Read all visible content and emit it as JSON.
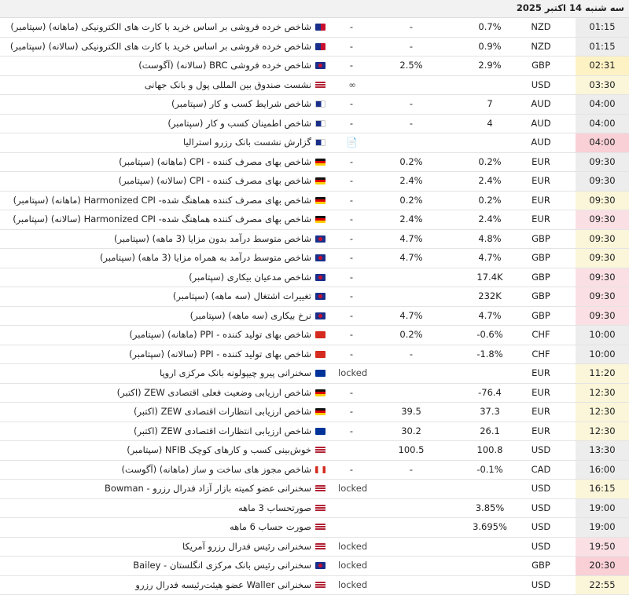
{
  "header": {
    "title": "سه شنبه 14 اکتبر 2025"
  },
  "events": [
    {
      "time": "01:15",
      "currency": "NZD",
      "actual": "0.7%",
      "forecast": "-",
      "previous": "-",
      "flag": "nz",
      "icon": "",
      "event": "شاخص خرده فروشی بر اساس خرید با کارت های الکترونیکی (ماهانه) (سپتامبر)",
      "highlight": ""
    },
    {
      "time": "01:15",
      "currency": "NZD",
      "actual": "0.9%",
      "forecast": "-",
      "previous": "-",
      "flag": "nz",
      "icon": "",
      "event": "شاخص خرده فروشی بر اساس خرید با کارت های الکترونیکی (سالانه) (سپتامبر)",
      "highlight": ""
    },
    {
      "time": "02:31",
      "currency": "GBP",
      "actual": "2.9%",
      "forecast": "2.5%",
      "previous": "-",
      "flag": "gb",
      "icon": "",
      "event": "شاخص خرده فروشی BRC (سالانه) (آگوست)",
      "highlight": "o"
    },
    {
      "time": "03:30",
      "currency": "USD",
      "actual": "",
      "forecast": "",
      "previous": "",
      "flag": "us",
      "icon": "∞",
      "event": "نشست صندوق بین المللی پول و بانک جهانی",
      "highlight": "y"
    },
    {
      "time": "04:00",
      "currency": "AUD",
      "actual": "7",
      "forecast": "-",
      "previous": "-",
      "flag": "au",
      "icon": "",
      "event": "شاخص شرایط کسب و کار (سپتامبر)",
      "highlight": ""
    },
    {
      "time": "04:00",
      "currency": "AUD",
      "actual": "4",
      "forecast": "-",
      "previous": "-",
      "flag": "au",
      "icon": "",
      "event": "شاخص اطمینان کسب و کار (سپتامبر)",
      "highlight": ""
    },
    {
      "time": "04:00",
      "currency": "AUD",
      "actual": "",
      "forecast": "",
      "previous": "",
      "flag": "au",
      "icon": "📄",
      "event": "گزارش نشست بانک رزرو استرالیا",
      "highlight": "r"
    },
    {
      "time": "09:30",
      "currency": "EUR",
      "actual": "0.2%",
      "forecast": "0.2%",
      "previous": "-",
      "flag": "de",
      "icon": "",
      "event": "شاخص بهای مصرف کننده - CPI (ماهانه) (سپتامبر)",
      "highlight": ""
    },
    {
      "time": "09:30",
      "currency": "EUR",
      "actual": "2.4%",
      "forecast": "2.4%",
      "previous": "-",
      "flag": "de",
      "icon": "",
      "event": "شاخص بهای مصرف کننده - CPI (سالانه) (سپتامبر)",
      "highlight": ""
    },
    {
      "time": "09:30",
      "currency": "EUR",
      "actual": "0.2%",
      "forecast": "0.2%",
      "previous": "-",
      "flag": "de",
      "icon": "",
      "event": "شاخص بهای مصرف کننده هماهنگ شده- Harmonized CPI (ماهانه) (سپتامبر)",
      "highlight": "y"
    },
    {
      "time": "09:30",
      "currency": "EUR",
      "actual": "2.4%",
      "forecast": "2.4%",
      "previous": "-",
      "flag": "de",
      "icon": "",
      "event": "شاخص بهای مصرف کننده هماهنگ شده- Harmonized CPI (سالانه) (سپتامبر)",
      "highlight": "p"
    },
    {
      "time": "09:30",
      "currency": "GBP",
      "actual": "4.8%",
      "forecast": "4.7%",
      "previous": "-",
      "flag": "gb",
      "icon": "",
      "event": "شاخص متوسط درآمد بدون مزایا (3 ماهه) (سپتامبر)",
      "highlight": "y"
    },
    {
      "time": "09:30",
      "currency": "GBP",
      "actual": "4.7%",
      "forecast": "4.7%",
      "previous": "-",
      "flag": "gb",
      "icon": "",
      "event": "شاخص متوسط درآمد به همراه مزایا (3 ماهه) (سپتامبر)",
      "highlight": "y"
    },
    {
      "time": "09:30",
      "currency": "GBP",
      "actual": "17.4K",
      "forecast": "",
      "previous": "-",
      "flag": "gb",
      "icon": "",
      "event": "شاخص مدعیان بیکاری (سپتامبر)",
      "highlight": "p"
    },
    {
      "time": "09:30",
      "currency": "GBP",
      "actual": "232K",
      "forecast": "",
      "previous": "-",
      "flag": "gb",
      "icon": "",
      "event": "تغییرات اشتغال (سه ماهه) (سپتامبر)",
      "highlight": "p"
    },
    {
      "time": "09:30",
      "currency": "GBP",
      "actual": "4.7%",
      "forecast": "4.7%",
      "previous": "-",
      "flag": "gb",
      "icon": "",
      "event": "نرخ بیکاری (سه ماهه) (سپتامبر)",
      "highlight": "p"
    },
    {
      "time": "10:00",
      "currency": "CHF",
      "actual": "-0.6%",
      "forecast": "0.2%",
      "previous": "-",
      "flag": "ch",
      "icon": "",
      "event": "شاخص بهای تولید کننده - PPI (ماهانه) (سپتامبر)",
      "highlight": ""
    },
    {
      "time": "10:00",
      "currency": "CHF",
      "actual": "-1.8%",
      "forecast": "-",
      "previous": "-",
      "flag": "ch",
      "icon": "",
      "event": "شاخص بهای تولید کننده - PPI (سالانه) (سپتامبر)",
      "highlight": ""
    },
    {
      "time": "11:20",
      "currency": "EUR",
      "actual": "",
      "forecast": "",
      "previous": "",
      "flag": "eu",
      "icon": "locked",
      "event": "سخنرانی پیرو چیپولونه بانک مرکزی اروپا",
      "highlight": "y"
    },
    {
      "time": "12:30",
      "currency": "EUR",
      "actual": "-76.4",
      "forecast": "",
      "previous": "-",
      "flag": "de",
      "icon": "",
      "event": "شاخص ارزیابی وضعیت فعلی اقتصادی ZEW (اکتبر)",
      "highlight": "y"
    },
    {
      "time": "12:30",
      "currency": "EUR",
      "actual": "37.3",
      "forecast": "39.5",
      "previous": "-",
      "flag": "de",
      "icon": "",
      "event": "شاخص ارزیابی انتظارات اقتصادی ZEW (اکتبر)",
      "highlight": "y"
    },
    {
      "time": "12:30",
      "currency": "EUR",
      "actual": "26.1",
      "forecast": "30.2",
      "previous": "-",
      "flag": "eu",
      "icon": "",
      "event": "شاخص ارزیابی انتظارات اقتصادی ZEW (اکتبر)",
      "highlight": "y"
    },
    {
      "time": "13:30",
      "currency": "USD",
      "actual": "100.8",
      "forecast": "100.5",
      "previous": "",
      "flag": "us",
      "icon": "",
      "event": "خوش‌بینی کسب و کارهای کوچک NFIB (سپتامبر)",
      "highlight": ""
    },
    {
      "time": "16:00",
      "currency": "CAD",
      "actual": "-0.1%",
      "forecast": "-",
      "previous": "-",
      "flag": "ca",
      "icon": "",
      "event": "شاخص مجوز های ساخت و ساز (ماهانه) (آگوست)",
      "highlight": ""
    },
    {
      "time": "16:15",
      "currency": "USD",
      "actual": "",
      "forecast": "",
      "previous": "",
      "flag": "us",
      "icon": "locked",
      "event": "سخنرانی عضو کمیته بازار آزاد فدرال رزرو - Bowman",
      "highlight": "y"
    },
    {
      "time": "19:00",
      "currency": "USD",
      "actual": "3.85%",
      "forecast": "",
      "previous": "",
      "flag": "us",
      "icon": "",
      "event": "صورتحساب 3 ماهه",
      "highlight": ""
    },
    {
      "time": "19:00",
      "currency": "USD",
      "actual": "3.695%",
      "forecast": "",
      "previous": "",
      "flag": "us",
      "icon": "",
      "event": "صورت حساب 6 ماهه",
      "highlight": ""
    },
    {
      "time": "19:50",
      "currency": "USD",
      "actual": "",
      "forecast": "",
      "previous": "",
      "flag": "us",
      "icon": "locked",
      "event": "سخنرانی رئیس فدرال رزرو آمریکا",
      "highlight": "p"
    },
    {
      "time": "20:30",
      "currency": "GBP",
      "actual": "",
      "forecast": "",
      "previous": "",
      "flag": "gb",
      "icon": "locked",
      "event": "سخنرانی رئیس بانک مرکزی انگلستان - Bailey",
      "highlight": "r"
    },
    {
      "time": "22:55",
      "currency": "USD",
      "actual": "",
      "forecast": "",
      "previous": "",
      "flag": "us",
      "icon": "locked",
      "event": "سخنرانی Waller عضو هیئت‌رئیسه فدرال رزرو",
      "highlight": "y"
    }
  ]
}
